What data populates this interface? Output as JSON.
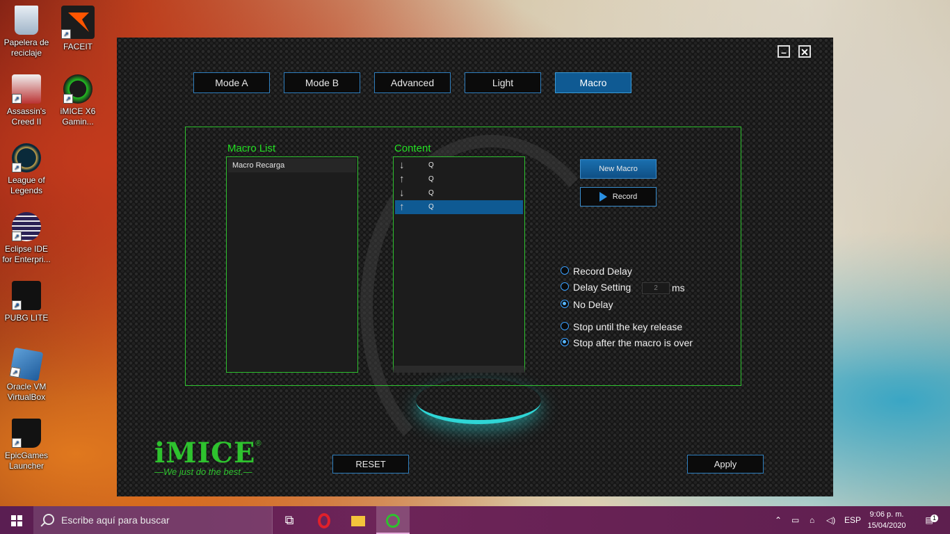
{
  "desktop": {
    "icons": [
      {
        "label": "Papelera de reciclaje",
        "icon": "recycle-bin-icon"
      },
      {
        "label": "FACEIT",
        "icon": "faceit-icon"
      },
      {
        "label": "Assassin's Creed II",
        "icon": "assassins-creed-icon"
      },
      {
        "label": "iMICE X6 Gamin...",
        "icon": "imice-icon"
      },
      {
        "label": "League of Legends",
        "icon": "league-icon"
      },
      {
        "label": "Eclipse IDE for Enterpri...",
        "icon": "eclipse-icon"
      },
      {
        "label": "PUBG LITE",
        "icon": "pubg-icon"
      },
      {
        "label": "Oracle VM VirtualBox",
        "icon": "virtualbox-icon"
      },
      {
        "label": "EpicGames Launcher",
        "icon": "epic-icon"
      }
    ]
  },
  "app": {
    "tabs": [
      {
        "label": "Mode A"
      },
      {
        "label": "Mode B"
      },
      {
        "label": "Advanced"
      },
      {
        "label": "Light"
      },
      {
        "label": "Macro",
        "active": true
      }
    ],
    "macro_list": {
      "title": "Macro List",
      "items": [
        "Macro Recarga"
      ]
    },
    "content": {
      "title": "Content",
      "rows": [
        {
          "direction": "down",
          "key": "Q"
        },
        {
          "direction": "up",
          "key": "Q"
        },
        {
          "direction": "down",
          "key": "Q"
        },
        {
          "direction": "up",
          "key": "Q",
          "selected": true
        }
      ]
    },
    "buttons": {
      "new_macro": "New Macro",
      "record": "Record",
      "reset": "RESET",
      "apply": "Apply"
    },
    "delay_options": [
      {
        "label": "Record Delay",
        "checked": false
      },
      {
        "label": "Delay Setting",
        "checked": false
      },
      {
        "label": "No Delay",
        "checked": true
      }
    ],
    "delay_value": "2",
    "delay_unit": "ms",
    "stop_options": [
      {
        "label": "Stop until the key release",
        "checked": false
      },
      {
        "label": "Stop after the macro is over",
        "checked": true
      }
    ],
    "logo": {
      "brand": "iMICE",
      "reg": "®",
      "tagline": "—We just do the best.—"
    }
  },
  "taskbar": {
    "search_placeholder": "Escribe aquí para buscar",
    "language": "ESP",
    "time": "9:06 p. m.",
    "date": "15/04/2020",
    "notification_count": "1"
  },
  "colors": {
    "accent_green": "#2ec22e",
    "accent_blue": "#0f5a93",
    "taskbar": "#6d2458"
  }
}
